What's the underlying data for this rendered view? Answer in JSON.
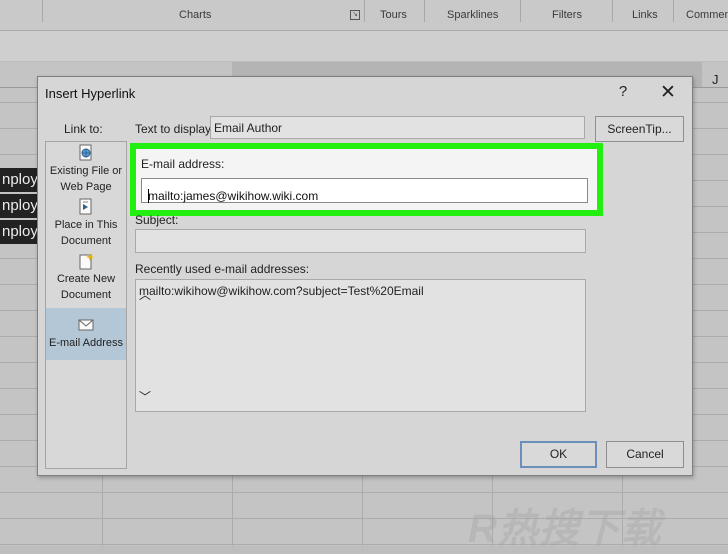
{
  "ribbon": {
    "groups": [
      "Charts",
      "Tours",
      "Sparklines",
      "Filters",
      "Links",
      "Commen"
    ]
  },
  "sheet": {
    "column_letter": "J",
    "row_labels": [
      "nploy",
      "nploy",
      "nploy"
    ]
  },
  "dialog": {
    "title": "Insert Hyperlink",
    "help_glyph": "?",
    "close_glyph": "✕",
    "link_to_label": "Link to:",
    "nav_items": [
      {
        "line1": "Existing File or",
        "line2": "Web Page",
        "icon": "file-globe-icon"
      },
      {
        "line1": "Place in This",
        "line2": "Document",
        "icon": "document-place-icon"
      },
      {
        "line1": "Create New",
        "line2": "Document",
        "icon": "new-document-icon"
      },
      {
        "line1": "E-mail Address",
        "line2": "",
        "icon": "email-icon"
      }
    ],
    "active_nav": "E-mail Address",
    "text_to_display_label": "Text to display:",
    "text_to_display_value": "Email Author",
    "screentip_button": "ScreenTip...",
    "email_label": "E-mail address:",
    "email_value": "mailto:james@wikihow.wiki.com",
    "subject_label": "Subject:",
    "subject_value": "",
    "recent_label": "Recently used e-mail addresses:",
    "recent_items": [
      "mailto:wikihow@wikihow.com?subject=Test%20Email"
    ],
    "ok_button": "OK",
    "cancel_button": "Cancel",
    "highlight_color": "#22ee10"
  },
  "watermark": {
    "text": "R热搜下载"
  }
}
